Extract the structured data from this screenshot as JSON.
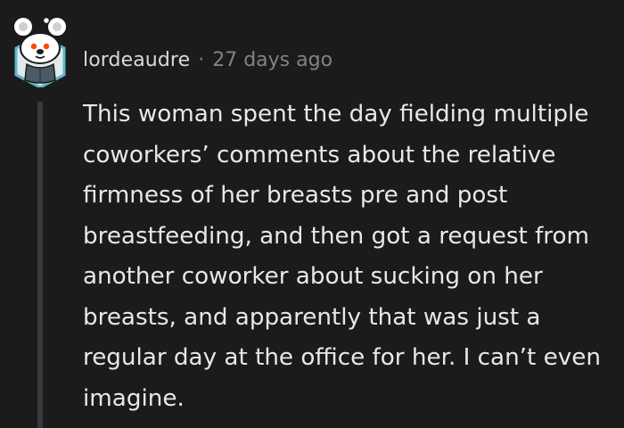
{
  "comment": {
    "username": "lordeaudre",
    "separator": "·",
    "timestamp": "27 days ago",
    "body": "This woman spent the day fielding multiple coworkers’ comments about the relative firmness of her breasts pre and post breastfeeding, and then got a request from another coworker about sucking on her breasts, and apparently that was just a regular day at the office for her. I can’t even imagine.",
    "avatar_icon": "reddit-snoo-koala-avatar-icon"
  },
  "colors": {
    "background": "#1b1b1b",
    "username": "#d7dadc",
    "meta": "#818384",
    "body_text": "#e8e8e8",
    "thread_line": "#3a3a3c",
    "avatar_border": "#5fb7c9"
  }
}
